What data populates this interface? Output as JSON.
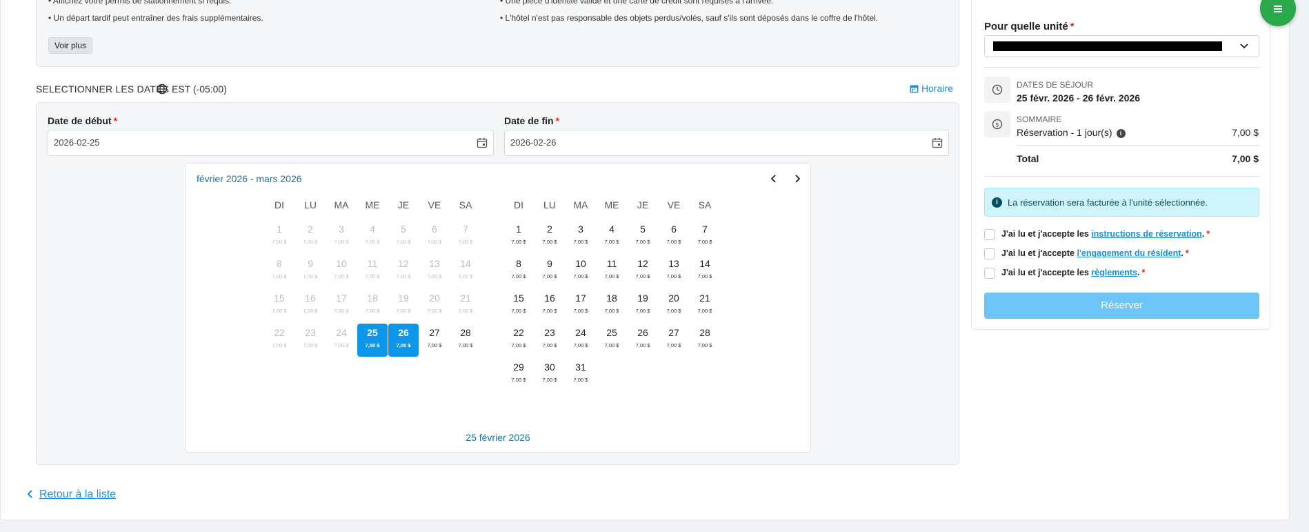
{
  "rules": {
    "left": [
      "• Affichez votre permis de stationnement si requis.",
      "• Un départ tardif peut entraîner des frais supplémentaires."
    ],
    "right": [
      "• Une pièce d'identité valide et une carte de crédit sont requises à l'arrivée.",
      "• L'hôtel n'est pas responsable des objets perdus/volés, sauf s'ils sont déposés dans le coffre de l'hôtel."
    ],
    "see_more": "Voir plus"
  },
  "dates_section": {
    "title": "SELECTIONNER LES DATES",
    "timezone": "EST (-05:00)",
    "schedule_link": "Horaire",
    "start_label": "Date de début",
    "end_label": "Date de fin",
    "required_mark": "*",
    "start_value": "2026-02-25",
    "end_value": "2026-02-26"
  },
  "calendar": {
    "range_label": "février 2026 - mars 2026",
    "weekdays": [
      "DI",
      "LU",
      "MA",
      "ME",
      "JE",
      "VE",
      "SA"
    ],
    "price": "7,00 $",
    "months": [
      {
        "name": "février 2026",
        "start_weekday": 0,
        "days": 28,
        "muted_until": 24,
        "selected": [
          25,
          26
        ]
      },
      {
        "name": "mars 2026",
        "start_weekday": 0,
        "days": 31,
        "muted_until": 0,
        "selected": []
      }
    ],
    "footer": "25 février 2026"
  },
  "back_link": "Retour à la liste",
  "side": {
    "unit_label": "Pour quelle unité",
    "required_mark": "*",
    "stay_caption": "DATES DE SÉJOUR",
    "stay_value": "25 févr. 2026 - 26 févr. 2026",
    "summary_caption": "SOMMAIRE",
    "summary_item": "Réservation - 1 jour(s)",
    "summary_item_price": "7,00 $",
    "info_glyph": "i",
    "total_label": "Total",
    "total_value": "7,00 $",
    "alert": "La réservation sera facturée à l'unité sélectionnée.",
    "checks": [
      {
        "prefix": "J'ai lu et j'accepte les ",
        "link": "instructions de réservation",
        "suffix": "."
      },
      {
        "prefix": "J'ai lu et j'accepte ",
        "link": "l'engagement du résident",
        "suffix": "."
      },
      {
        "prefix": "J'ai lu et j'accepte les ",
        "link": "règlements",
        "suffix": "."
      }
    ],
    "reserve_button": "Réserver"
  },
  "colors": {
    "accent": "#1a8fd8",
    "selected_day": "#0d97ea",
    "fab": "#2aa84a",
    "alert_bg": "#cff4fb",
    "reserve_button": "#6cc4f7"
  },
  "icons": [
    "globe-icon",
    "calendar-icon",
    "chevron-left-icon",
    "chevron-right-icon",
    "clock-icon",
    "dollar-icon",
    "info-icon",
    "menu-icon",
    "chevron-down-icon"
  ]
}
